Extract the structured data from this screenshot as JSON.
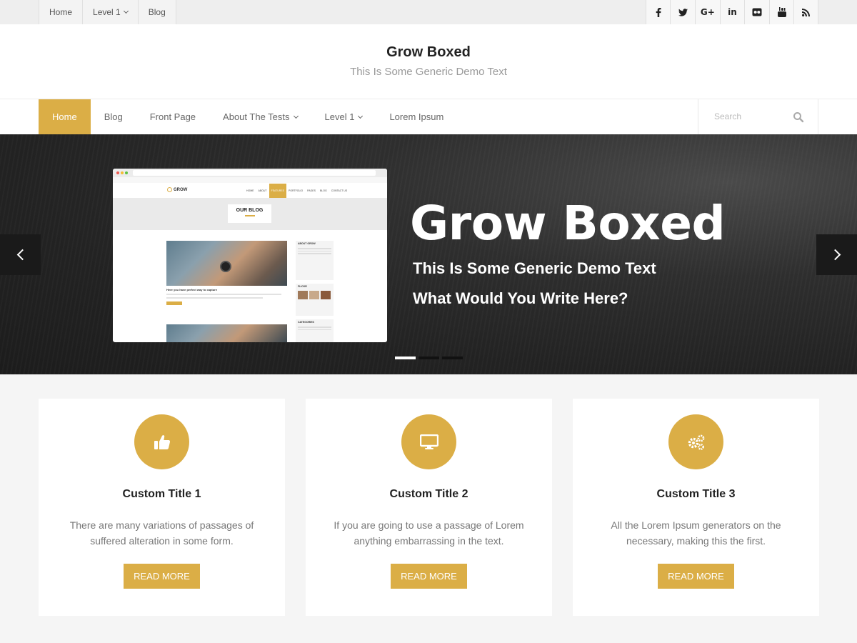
{
  "topbar": {
    "menu": [
      {
        "label": "Home"
      },
      {
        "label": "Level 1",
        "has_dropdown": true
      },
      {
        "label": "Blog"
      }
    ],
    "social": [
      {
        "icon": "facebook-icon",
        "glyph": "f"
      },
      {
        "icon": "twitter-icon",
        "glyph": "t"
      },
      {
        "icon": "google-plus-icon",
        "glyph": "G+"
      },
      {
        "icon": "linkedin-icon",
        "glyph": "in"
      },
      {
        "icon": "flickr-icon",
        "glyph": "●●"
      },
      {
        "icon": "youtube-icon",
        "glyph": "▶"
      },
      {
        "icon": "rss-icon",
        "glyph": "◔"
      }
    ]
  },
  "header": {
    "title": "Grow Boxed",
    "description": "This Is Some Generic Demo Text"
  },
  "nav": {
    "items": [
      {
        "label": "Home",
        "active": true
      },
      {
        "label": "Blog"
      },
      {
        "label": "Front Page"
      },
      {
        "label": "About The Tests",
        "has_dropdown": true
      },
      {
        "label": "Level 1",
        "has_dropdown": true
      },
      {
        "label": "Lorem Ipsum"
      }
    ],
    "search_placeholder": "Search"
  },
  "slider": {
    "title": "Grow Boxed",
    "line1": "This Is Some Generic Demo Text",
    "line2": "What Would You Write Here?",
    "slide_count": 3,
    "active_slide": 1,
    "preview": {
      "logo": "GROW",
      "nav": [
        "HOME",
        "ABOUT",
        "FEATURES",
        "PORTFOLIO",
        "PAGES",
        "BLOG",
        "CONTACT US"
      ],
      "banner_title": "OUR BLOG",
      "post_title": "Here you have perfect way to capture",
      "sidebar": [
        "ABOUT GROW",
        "FLICKR",
        "CATEGORIES"
      ]
    }
  },
  "features": [
    {
      "icon": "thumbs-up-icon",
      "title": "Custom Title 1",
      "text": "There are many variations of passages of suffered alteration in some form.",
      "button": "Read More"
    },
    {
      "icon": "monitor-icon",
      "title": "Custom Title 2",
      "text": "If you are going to use a passage of Lorem anything embarrassing in the text.",
      "button": "Read More"
    },
    {
      "icon": "gears-icon",
      "title": "Custom Title 3",
      "text": "All the Lorem Ipsum generators on the necessary, making this the first.",
      "button": "Read More"
    }
  ],
  "colors": {
    "accent": "#dbae46",
    "slider_bg": "#2a2a2a",
    "page_bg": "#f5f5f5"
  }
}
